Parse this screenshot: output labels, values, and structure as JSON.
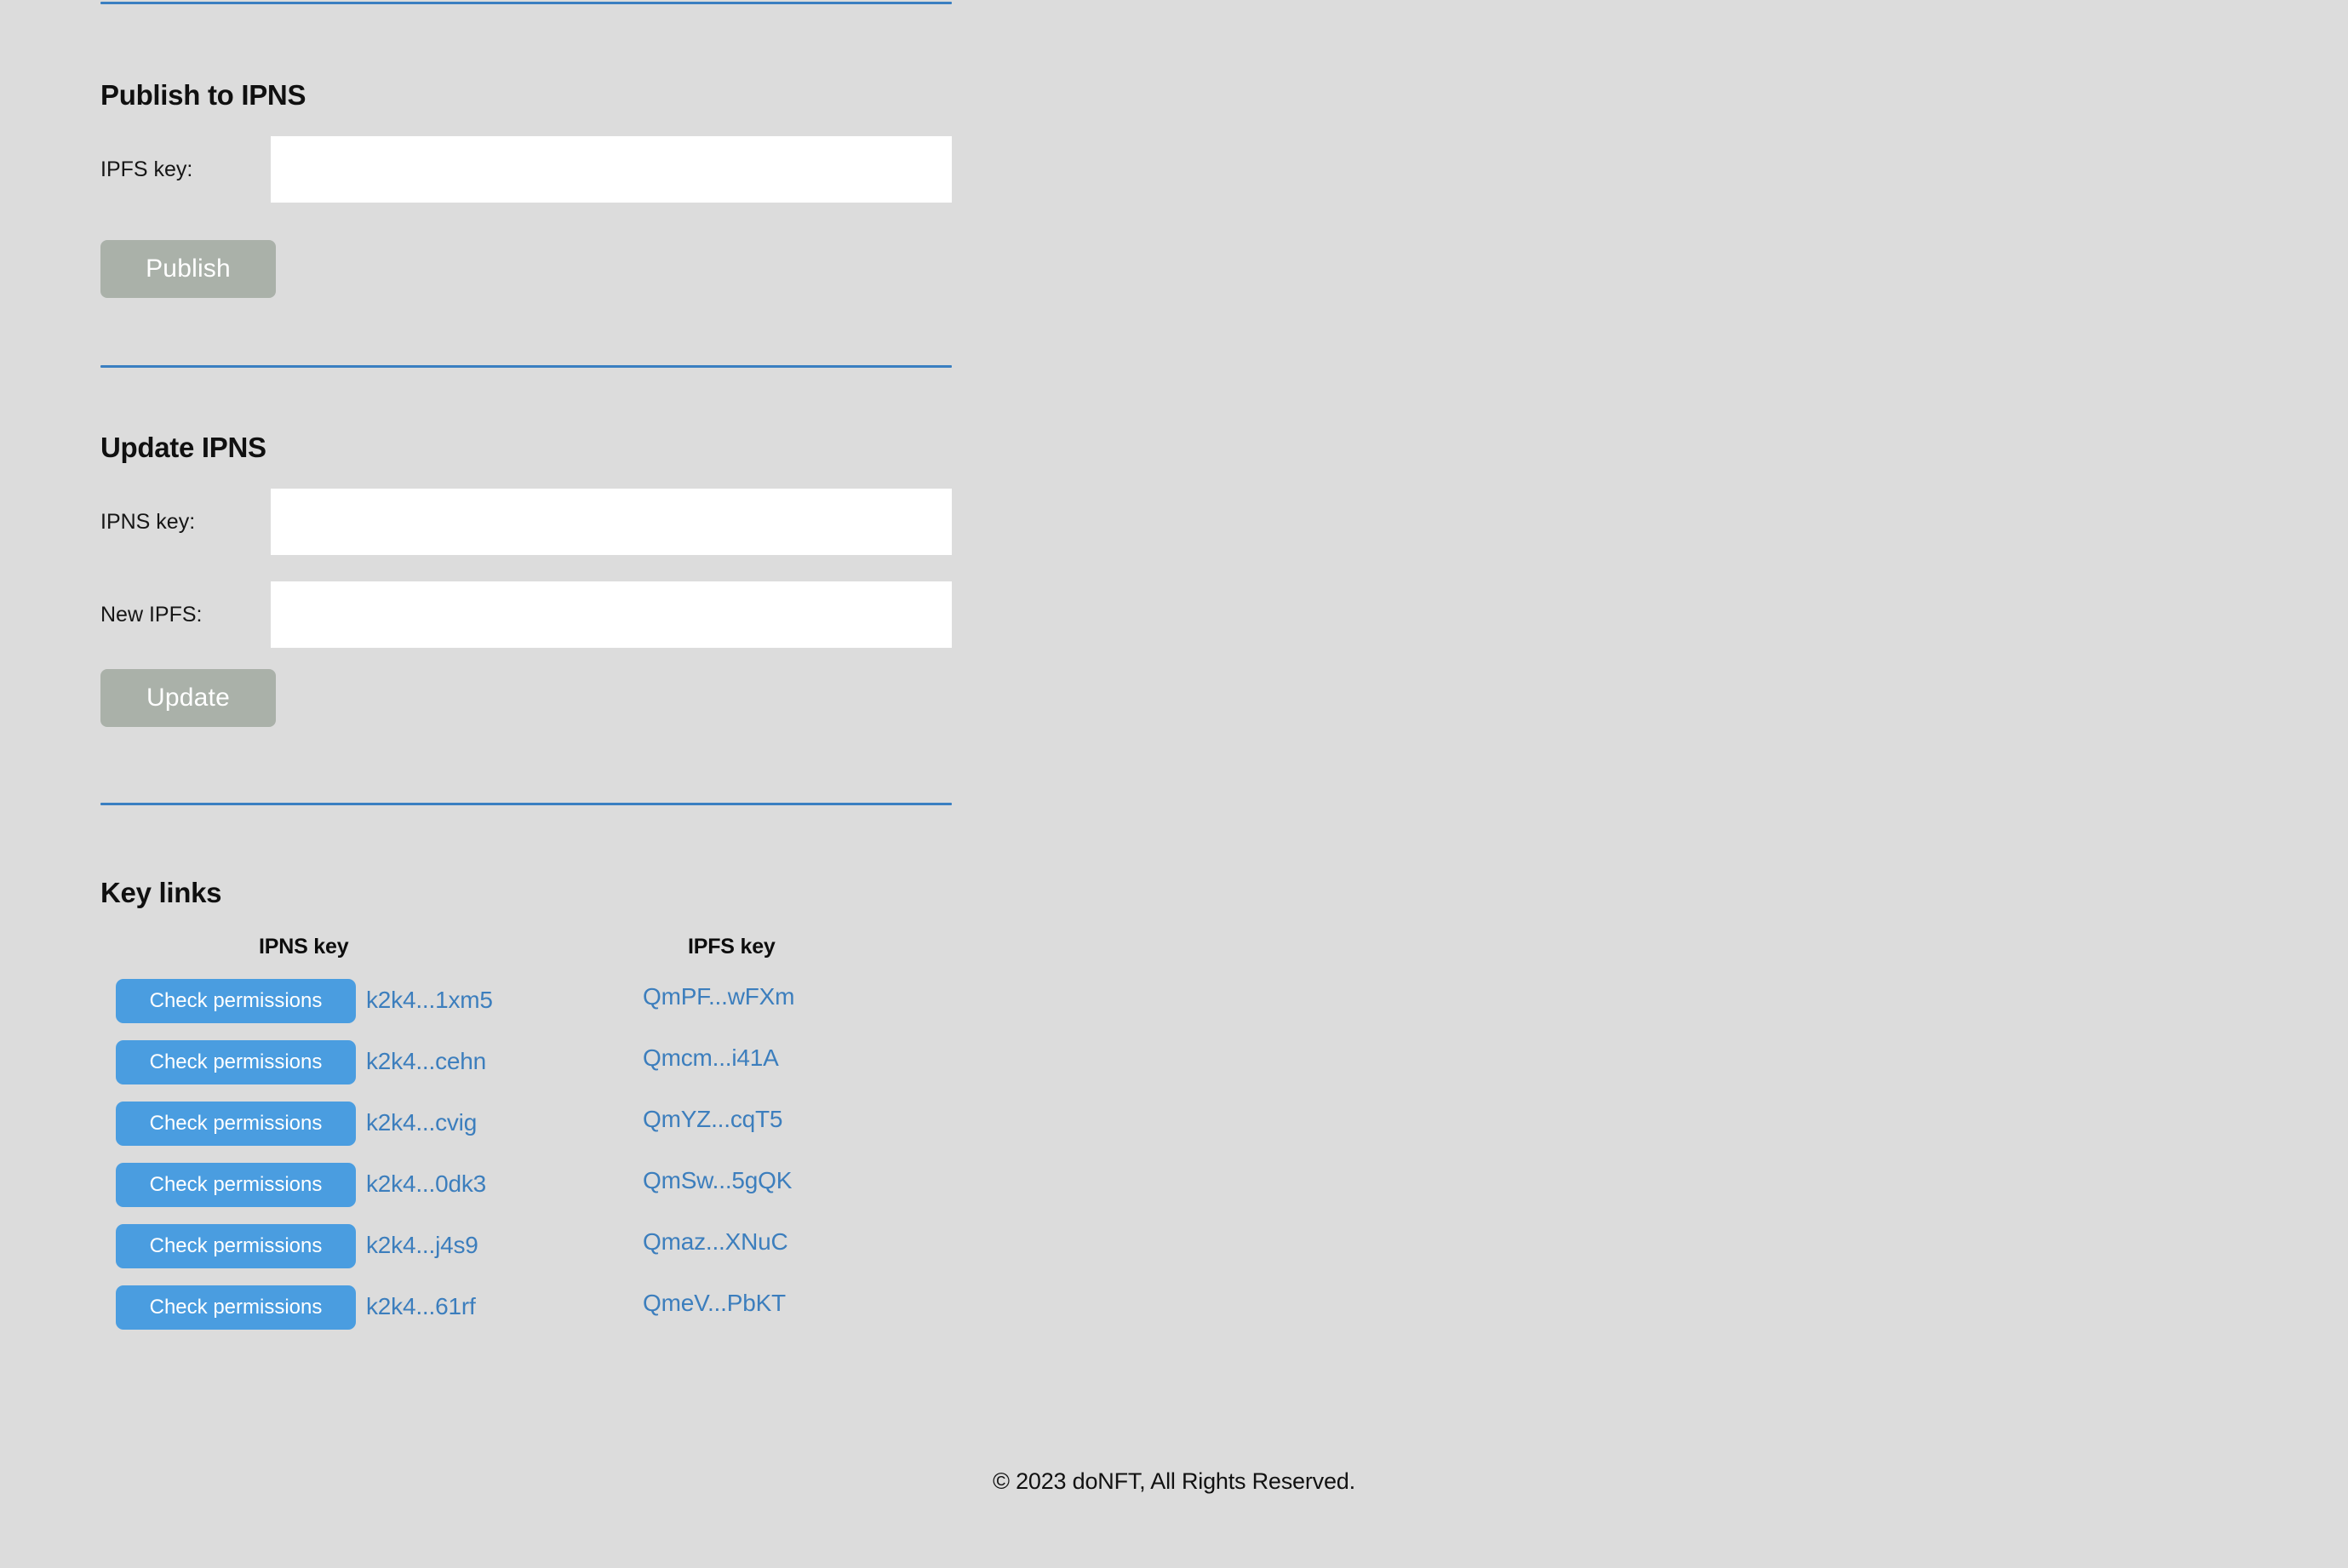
{
  "sections": {
    "publish": {
      "heading": "Publish to IPNS",
      "ipfs_key_label": "IPFS key:",
      "ipfs_key_value": "",
      "ipfs_key_placeholder": "",
      "submit_label": "Publish"
    },
    "update": {
      "heading": "Update IPNS",
      "ipns_key_label": "IPNS key:",
      "ipns_key_value": "",
      "ipns_key_placeholder": "",
      "new_ipfs_label": "New IPFS:",
      "new_ipfs_value": "",
      "new_ipfs_placeholder": "",
      "submit_label": "Update"
    },
    "key_links": {
      "heading": "Key links",
      "columns": {
        "ipns": "IPNS key",
        "ipfs": "IPFS key"
      },
      "check_permissions_label": "Check permissions",
      "rows": [
        {
          "ipns": "k2k4...1xm5",
          "ipfs": "QmPF...wFXm"
        },
        {
          "ipns": "k2k4...cehn",
          "ipfs": "Qmcm...i41A"
        },
        {
          "ipns": "k2k4...cvig",
          "ipfs": "QmYZ...cqT5"
        },
        {
          "ipns": "k2k4...0dk3",
          "ipfs": "QmSw...5gQK"
        },
        {
          "ipns": "k2k4...j4s9",
          "ipfs": "Qmaz...XNuC"
        },
        {
          "ipns": "k2k4...61rf",
          "ipfs": "QmeV...PbKT"
        }
      ]
    }
  },
  "footer": {
    "copyright": "© 2023 doNFT, All Rights Reserved."
  },
  "colors": {
    "page_background": "#dcdcdc",
    "divider": "#3a7fc1",
    "disabled_button": "#aab1a9",
    "primary_button": "#4a9de0",
    "link": "#3c7ebd",
    "input_background": "#ffffff",
    "text": "#111111"
  }
}
